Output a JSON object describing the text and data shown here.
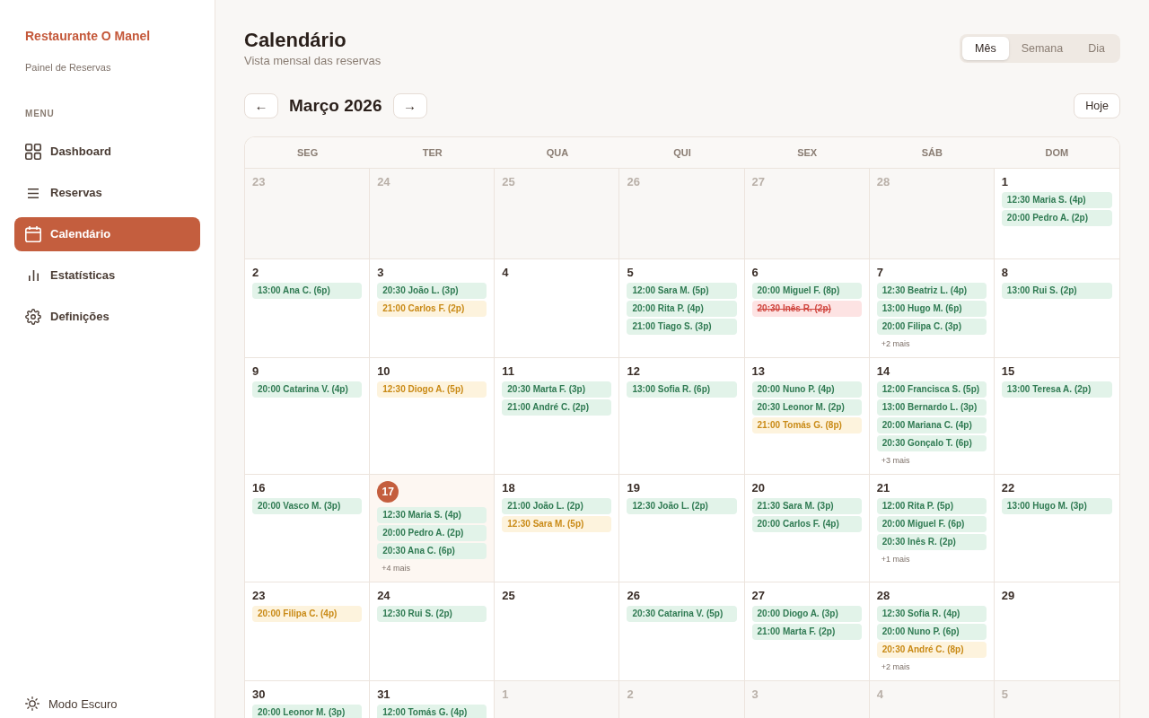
{
  "sidebar": {
    "brand": "Restaurante O Manel",
    "subtitle": "Painel de Reservas",
    "section_label": "MENU",
    "items": [
      {
        "label": "Dashboard",
        "selected": false
      },
      {
        "label": "Reservas",
        "selected": false
      },
      {
        "label": "Calendário",
        "selected": true
      },
      {
        "label": "Estatísticas",
        "selected": false
      },
      {
        "label": "Definições",
        "selected": false
      }
    ],
    "footer_item": {
      "label": "Modo Escuro"
    }
  },
  "header": {
    "title": "Calendário",
    "subtitle": "Vista mensal das reservas",
    "view_switcher": [
      {
        "label": "Mês",
        "selected": true
      },
      {
        "label": "Semana",
        "selected": false
      },
      {
        "label": "Dia",
        "selected": false
      }
    ]
  },
  "month_nav": {
    "previous": "←",
    "month": "Março 2026",
    "next": "→",
    "today_button": "Hoje"
  },
  "calendar": {
    "weekdays": [
      "SEG",
      "TER",
      "QUA",
      "QUI",
      "SEX",
      "SÁB",
      "DOM"
    ],
    "weeks": [
      {
        "days": [
          {
            "day": "23",
            "in_month": false,
            "today": false
          },
          {
            "day": "24",
            "in_month": false,
            "today": false
          },
          {
            "day": "25",
            "in_month": false,
            "today": false
          },
          {
            "day": "26",
            "in_month": false,
            "today": false
          },
          {
            "day": "27",
            "in_month": false,
            "today": false
          },
          {
            "day": "28",
            "in_month": false,
            "today": false
          },
          {
            "day": "1",
            "in_month": true,
            "today": false,
            "events": [
              {
                "text": "12:30 Maria S. (4p)",
                "kind": "confirmed"
              },
              {
                "text": "20:00 Pedro A. (2p)",
                "kind": "confirmed"
              }
            ]
          }
        ]
      },
      {
        "days": [
          {
            "day": "2",
            "in_month": true,
            "today": false,
            "events": [
              {
                "text": "13:00 Ana C. (6p)",
                "kind": "confirmed"
              }
            ]
          },
          {
            "day": "3",
            "in_month": true,
            "today": false,
            "events": [
              {
                "text": "20:30 João L. (3p)",
                "kind": "confirmed"
              },
              {
                "text": "21:00 Carlos F. (2p)",
                "kind": "pending"
              }
            ]
          },
          {
            "day": "4",
            "in_month": true,
            "today": false
          },
          {
            "day": "5",
            "in_month": true,
            "today": false,
            "events": [
              {
                "text": "12:00 Sara M. (5p)",
                "kind": "confirmed"
              },
              {
                "text": "20:00 Rita P. (4p)",
                "kind": "confirmed"
              },
              {
                "text": "21:00 Tiago S. (3p)",
                "kind": "confirmed"
              }
            ]
          },
          {
            "day": "6",
            "in_month": true,
            "today": false,
            "events": [
              {
                "text": "20:00 Miguel F. (8p)",
                "kind": "confirmed"
              },
              {
                "text": "20:30 Inês R. (2p)",
                "kind": "cancelled"
              }
            ]
          },
          {
            "day": "7",
            "in_month": true,
            "today": false,
            "events": [
              {
                "text": "12:30 Beatriz L. (4p)",
                "kind": "confirmed"
              },
              {
                "text": "13:00 Hugo M. (6p)",
                "kind": "confirmed"
              },
              {
                "text": "20:00 Filipa C. (3p)",
                "kind": "confirmed"
              }
            ],
            "more": "+2 mais"
          },
          {
            "day": "8",
            "in_month": true,
            "today": false,
            "events": [
              {
                "text": "13:00 Rui S. (2p)",
                "kind": "confirmed"
              }
            ]
          }
        ]
      },
      {
        "days": [
          {
            "day": "9",
            "in_month": true,
            "today": false,
            "events": [
              {
                "text": "20:00 Catarina V. (4p)",
                "kind": "confirmed"
              }
            ]
          },
          {
            "day": "10",
            "in_month": true,
            "today": false,
            "events": [
              {
                "text": "12:30 Diogo A. (5p)",
                "kind": "pending"
              }
            ]
          },
          {
            "day": "11",
            "in_month": true,
            "today": false,
            "events": [
              {
                "text": "20:30 Marta F. (3p)",
                "kind": "confirmed"
              },
              {
                "text": "21:00 André C. (2p)",
                "kind": "confirmed"
              }
            ]
          },
          {
            "day": "12",
            "in_month": true,
            "today": false,
            "events": [
              {
                "text": "13:00 Sofia R. (6p)",
                "kind": "confirmed"
              }
            ]
          },
          {
            "day": "13",
            "in_month": true,
            "today": false,
            "events": [
              {
                "text": "20:00 Nuno P. (4p)",
                "kind": "confirmed"
              },
              {
                "text": "20:30 Leonor M. (2p)",
                "kind": "confirmed"
              },
              {
                "text": "21:00 Tomás G. (8p)",
                "kind": "pending"
              }
            ]
          },
          {
            "day": "14",
            "in_month": true,
            "today": false,
            "events": [
              {
                "text": "12:00 Francisca S. (5p)",
                "kind": "confirmed"
              },
              {
                "text": "13:00 Bernardo L. (3p)",
                "kind": "confirmed"
              },
              {
                "text": "20:00 Mariana C. (4p)",
                "kind": "confirmed"
              },
              {
                "text": "20:30 Gonçalo T. (6p)",
                "kind": "confirmed"
              }
            ],
            "more": "+3 mais"
          },
          {
            "day": "15",
            "in_month": true,
            "today": false,
            "events": [
              {
                "text": "13:00 Teresa A. (2p)",
                "kind": "confirmed"
              }
            ]
          }
        ]
      },
      {
        "days": [
          {
            "day": "16",
            "in_month": true,
            "today": false,
            "events": [
              {
                "text": "20:00 Vasco M. (3p)",
                "kind": "confirmed"
              }
            ]
          },
          {
            "day": "17",
            "in_month": true,
            "today": true,
            "events": [
              {
                "text": "12:30 Maria S. (4p)",
                "kind": "confirmed"
              },
              {
                "text": "20:00 Pedro A. (2p)",
                "kind": "confirmed"
              },
              {
                "text": "20:30 Ana C. (6p)",
                "kind": "confirmed"
              }
            ],
            "more": "+4 mais"
          },
          {
            "day": "18",
            "in_month": true,
            "today": false,
            "events": [
              {
                "text": "21:00 João L. (2p)",
                "kind": "confirmed"
              },
              {
                "text": "12:30 Sara M. (5p)",
                "kind": "pending"
              }
            ]
          },
          {
            "day": "19",
            "in_month": true,
            "today": false,
            "events": [
              {
                "text": "12:30 João L. (2p)",
                "kind": "confirmed"
              }
            ]
          },
          {
            "day": "20",
            "in_month": true,
            "today": false,
            "events": [
              {
                "text": "21:30 Sara M. (3p)",
                "kind": "confirmed"
              },
              {
                "text": "20:00 Carlos F. (4p)",
                "kind": "confirmed"
              }
            ]
          },
          {
            "day": "21",
            "in_month": true,
            "today": false,
            "events": [
              {
                "text": "12:00 Rita P. (5p)",
                "kind": "confirmed"
              },
              {
                "text": "20:00 Miguel F. (6p)",
                "kind": "confirmed"
              },
              {
                "text": "20:30 Inês R. (2p)",
                "kind": "confirmed"
              }
            ],
            "more": "+1 mais"
          },
          {
            "day": "22",
            "in_month": true,
            "today": false,
            "events": [
              {
                "text": "13:00 Hugo M. (3p)",
                "kind": "confirmed"
              }
            ]
          }
        ]
      },
      {
        "days": [
          {
            "day": "23",
            "in_month": true,
            "today": false,
            "events": [
              {
                "text": "20:00 Filipa C. (4p)",
                "kind": "pending"
              }
            ]
          },
          {
            "day": "24",
            "in_month": true,
            "today": false,
            "events": [
              {
                "text": "12:30 Rui S. (2p)",
                "kind": "confirmed"
              }
            ]
          },
          {
            "day": "25",
            "in_month": true,
            "today": false
          },
          {
            "day": "26",
            "in_month": true,
            "today": false,
            "events": [
              {
                "text": "20:30 Catarina V. (5p)",
                "kind": "confirmed"
              }
            ]
          },
          {
            "day": "27",
            "in_month": true,
            "today": false,
            "events": [
              {
                "text": "20:00 Diogo A. (3p)",
                "kind": "confirmed"
              },
              {
                "text": "21:00 Marta F. (2p)",
                "kind": "confirmed"
              }
            ]
          },
          {
            "day": "28",
            "in_month": true,
            "today": false,
            "events": [
              {
                "text": "12:30 Sofia R. (4p)",
                "kind": "confirmed"
              },
              {
                "text": "20:00 Nuno P. (6p)",
                "kind": "confirmed"
              },
              {
                "text": "20:30 André C. (8p)",
                "kind": "pending"
              }
            ],
            "more": "+2 mais"
          },
          {
            "day": "29",
            "in_month": true,
            "today": false
          }
        ]
      },
      {
        "days": [
          {
            "day": "30",
            "in_month": true,
            "today": false,
            "events": [
              {
                "text": "20:00 Leonor M. (3p)",
                "kind": "confirmed"
              }
            ]
          },
          {
            "day": "31",
            "in_month": true,
            "today": false,
            "events": [
              {
                "text": "12:00 Tomás G. (4p)",
                "kind": "confirmed"
              }
            ]
          },
          {
            "day": "1",
            "in_month": false,
            "today": false
          },
          {
            "day": "2",
            "in_month": false,
            "today": false
          },
          {
            "day": "3",
            "in_month": false,
            "today": false
          },
          {
            "day": "4",
            "in_month": false,
            "today": false
          },
          {
            "day": "5",
            "in_month": false,
            "today": false
          }
        ]
      }
    ]
  }
}
